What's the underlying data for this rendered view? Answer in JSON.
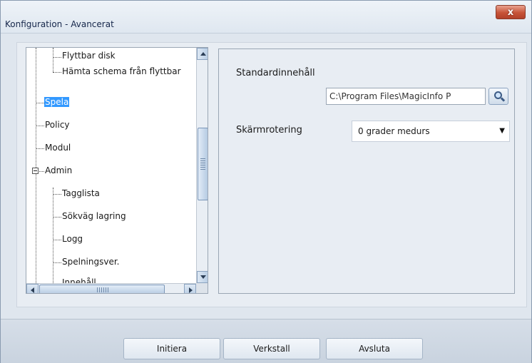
{
  "window": {
    "title": "Konfiguration - Avancerat",
    "close_glyph": "x"
  },
  "tree": {
    "items": [
      {
        "label": "Flyttbar disk"
      },
      {
        "label": "Hämta schema från flyttbar"
      },
      {
        "label": "Spela",
        "selected": true
      },
      {
        "label": "Policy"
      },
      {
        "label": "Modul"
      },
      {
        "label": "Admin",
        "expanded": true
      },
      {
        "label": "Tagglista"
      },
      {
        "label": "Sökväg lagring"
      },
      {
        "label": "Logg"
      },
      {
        "label": "Spelningsver."
      },
      {
        "label": "Innehåll"
      }
    ],
    "expander_glyph": "−"
  },
  "settings": {
    "default_content_label": "Standardinnehåll",
    "default_content_value": "C:\\Program Files\\MagicInfo P",
    "browse_icon": "search-icon",
    "rotation_label": "Skärmrotering",
    "rotation_value": "0 grader medurs",
    "rotation_caret": "▼"
  },
  "buttons": {
    "initiera": "Initiera",
    "verkstall": "Verkstall",
    "avsluta": "Avsluta"
  },
  "colors": {
    "selection": "#3399ff",
    "close_button": "#c75338"
  }
}
